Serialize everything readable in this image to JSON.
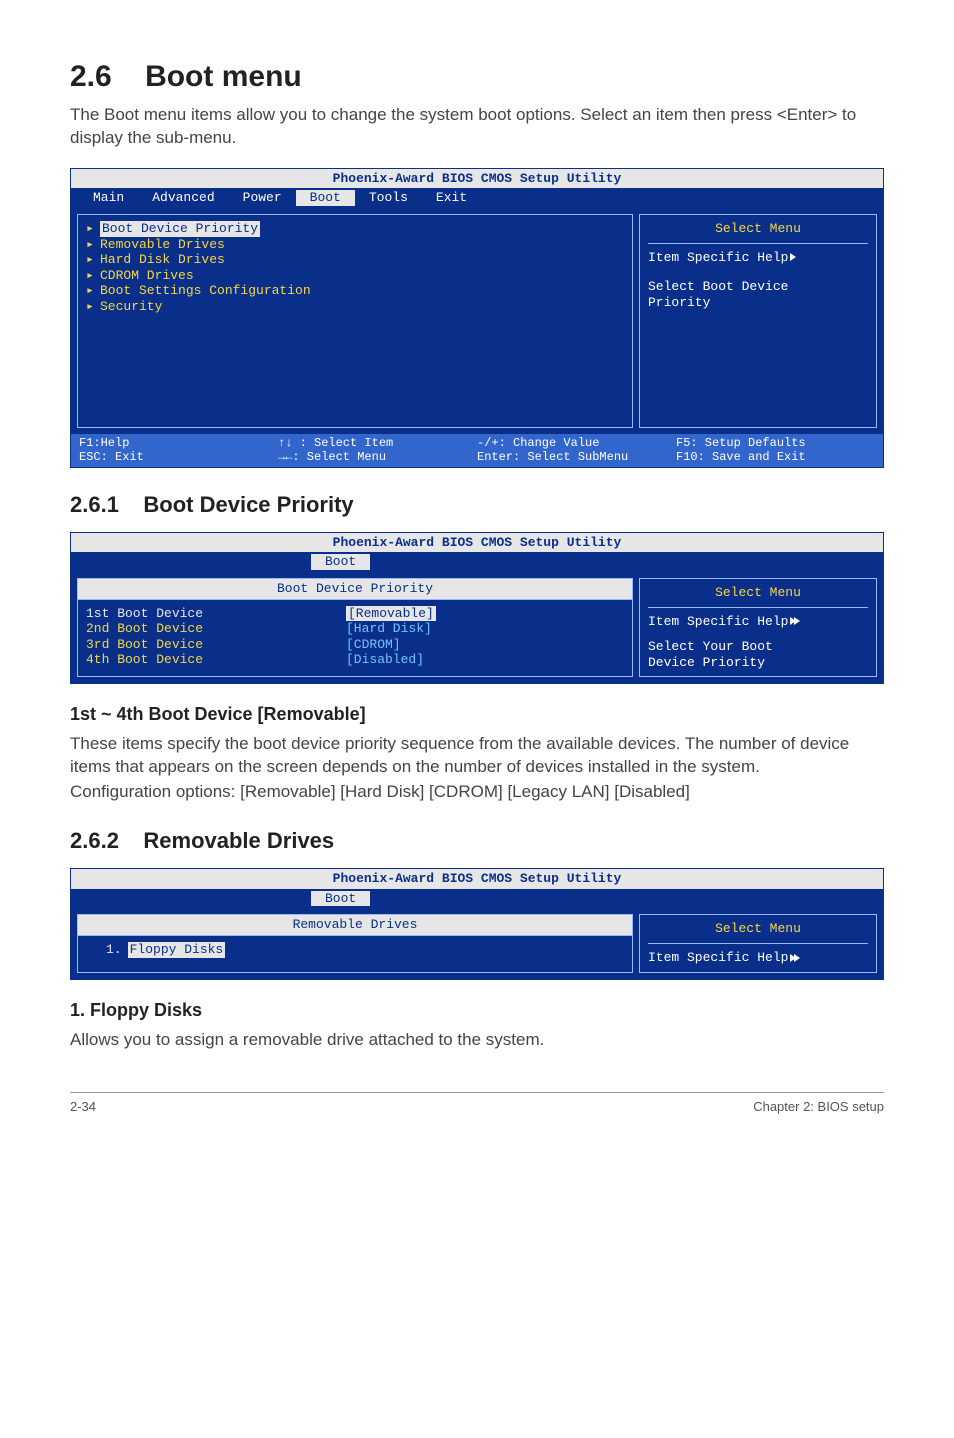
{
  "section": {
    "number": "2.6",
    "title": "Boot menu",
    "intro": "The Boot menu items allow you to change the system boot options. Select an item then press <Enter> to display the sub-menu."
  },
  "bios1": {
    "title": "Phoenix-Award BIOS CMOS Setup Utility",
    "menubar": [
      "Main",
      "Advanced",
      "Power",
      "Boot",
      "Tools",
      "Exit"
    ],
    "active_tab": "Boot",
    "items": [
      "Boot Device Priority",
      "Removable Drives",
      "Hard Disk Drives",
      "CDROM Drives",
      "Boot Settings Configuration",
      "Security"
    ],
    "selected_index": 0,
    "right": {
      "menu": "Select Menu",
      "help_label": "Item Specific Help",
      "help_text1": "Select Boot Device",
      "help_text2": "Priority"
    },
    "footer": {
      "c1a": "F1:Help",
      "c1b": "ESC: Exit",
      "c2a": "↑↓ : Select Item",
      "c2b": "→←: Select Menu",
      "c3a": "-/+: Change Value",
      "c3b": "Enter: Select SubMenu",
      "c4a": "F5: Setup Defaults",
      "c4b": "F10: Save and Exit"
    }
  },
  "sub261": {
    "number": "2.6.1",
    "title": "Boot Device Priority"
  },
  "bios2": {
    "title": "Phoenix-Award BIOS CMOS Setup Utility",
    "tab": "Boot",
    "subheader": "Boot Device Priority",
    "rows": [
      {
        "label": "1st Boot Device",
        "value": "[Removable]",
        "selected": true
      },
      {
        "label": "2nd Boot Device",
        "value": "[Hard Disk]"
      },
      {
        "label": "3rd Boot Device",
        "value": "[CDROM]"
      },
      {
        "label": "4th Boot Device",
        "value": "[Disabled]"
      }
    ],
    "right": {
      "menu": "Select Menu",
      "help_label": "Item Specific Help",
      "help_text1": "Select Your Boot",
      "help_text2": "Device Priority"
    }
  },
  "field1": {
    "title": "1st ~ 4th Boot Device [Removable]",
    "p1": "These items specify the boot device priority sequence from the available devices. The number of device items that appears on the screen depends on the number of devices installed in the system.",
    "p2": "Configuration options: [Removable] [Hard Disk] [CDROM] [Legacy LAN] [Disabled]"
  },
  "sub262": {
    "number": "2.6.2",
    "title": "Removable Drives"
  },
  "bios3": {
    "title": "Phoenix-Award BIOS CMOS Setup Utility",
    "tab": "Boot",
    "subheader": "Removable Drives",
    "row_num": "1.",
    "row_label": "Floppy Disks",
    "right": {
      "menu": "Select Menu",
      "help_label": "Item Specific Help"
    }
  },
  "field2": {
    "title": "1. Floppy Disks",
    "p1": "Allows you to assign a removable drive attached to the system."
  },
  "footer": {
    "left": "2-34",
    "right": "Chapter 2: BIOS setup"
  }
}
